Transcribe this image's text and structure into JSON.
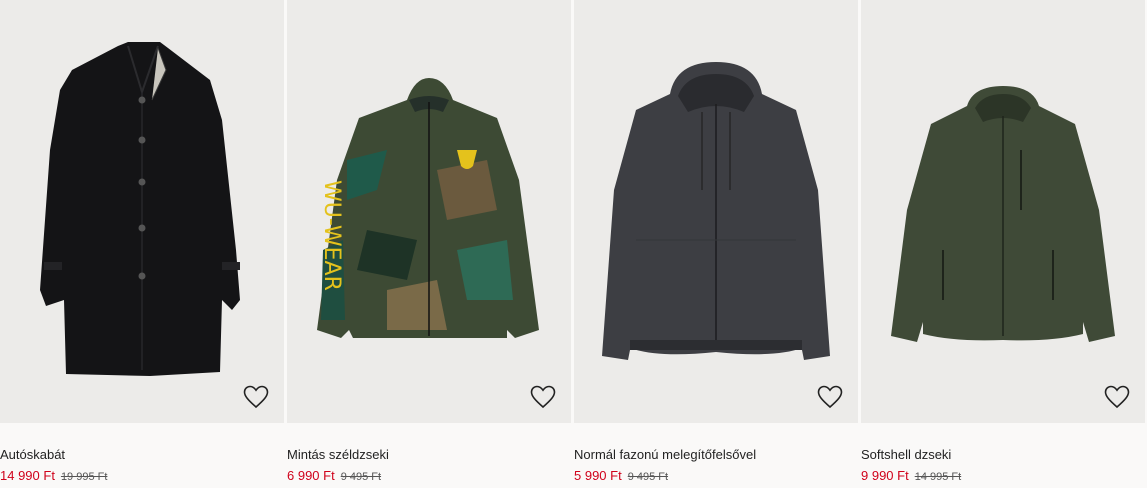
{
  "products": [
    {
      "title": "Autóskabát",
      "price": "14 990 Ft",
      "old_price": "19 995 Ft",
      "image_kind": "black-wool-coat"
    },
    {
      "title": "Mintás széldzseki",
      "price": "6 990 Ft",
      "old_price": "9 495 Ft",
      "image_kind": "camo-windbreaker"
    },
    {
      "title": "Normál fazonú melegítőfelsővel",
      "price": "5 990 Ft",
      "old_price": "9 495 Ft",
      "image_kind": "grey-hoodie"
    },
    {
      "title": "Softshell dzseki",
      "price": "9 990 Ft",
      "old_price": "14 995 Ft",
      "image_kind": "olive-softshell"
    }
  ],
  "icons": {
    "favorite": "heart-outline-icon"
  },
  "colors": {
    "sale_price": "#d0021b",
    "text": "#222222",
    "image_bg": "#ecebe9"
  }
}
